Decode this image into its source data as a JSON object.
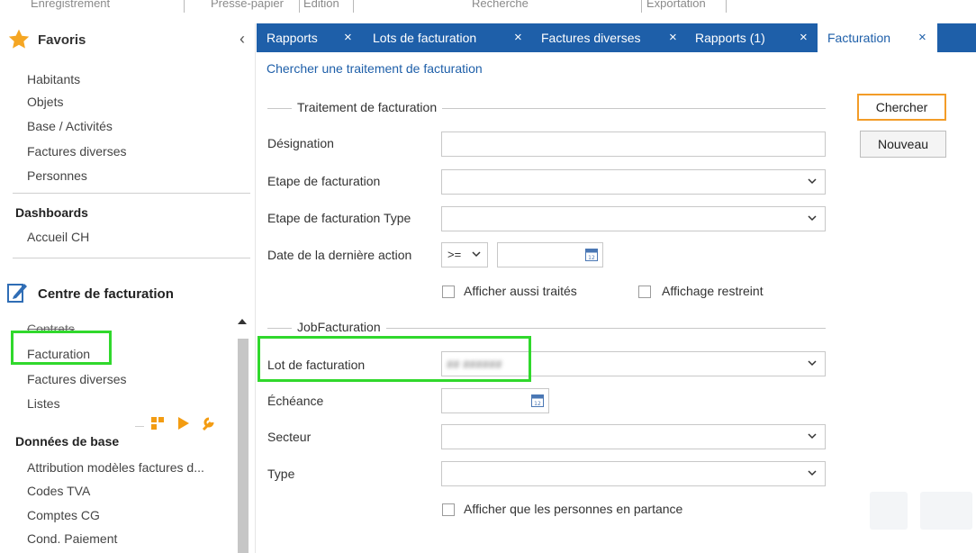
{
  "ribbon": {
    "groups": [
      "Enregistrement",
      "Presse-papier",
      "Edition",
      "Recherche",
      "Exportation"
    ]
  },
  "sidebar": {
    "favorites_title": "Favoris",
    "collapse_glyph": "‹",
    "favorites": [
      "Habitants",
      "Objets",
      "Base / Activités",
      "Factures diverses",
      "Personnes"
    ],
    "dashboards_title": "Dashboards",
    "dashboards": [
      "Accueil CH"
    ],
    "centre_title": "Centre de facturation",
    "centre_items": [
      "Contrats",
      "Facturation",
      "Factures diverses",
      "Listes"
    ],
    "base_title": "Données de base",
    "base_items": [
      "Attribution modèles factures d...",
      "Codes TVA",
      "Comptes CG",
      "Cond. Paiement"
    ],
    "tool_icons": [
      "blocks-icon",
      "play-icon",
      "wrench-icon"
    ]
  },
  "tabs": [
    {
      "label": "Rapports",
      "active": false
    },
    {
      "label": "Lots de facturation",
      "active": false
    },
    {
      "label": "Factures diverses",
      "active": false
    },
    {
      "label": "Rapports (1)",
      "active": false
    },
    {
      "label": "Facturation",
      "active": true
    }
  ],
  "tab_close_glyph": "×",
  "content": {
    "title": "Chercher une traitement de facturation",
    "section1": "Traitement de facturation",
    "section2": "JobFacturation",
    "fields": {
      "designation": {
        "label": "Désignation",
        "value": ""
      },
      "etape": {
        "label": "Etape de facturation",
        "value": ""
      },
      "etape_type": {
        "label": "Etape de facturation Type",
        "value": ""
      },
      "date_action": {
        "label": "Date de la dernière action",
        "operator": ">=",
        "value": ""
      },
      "lot": {
        "label": "Lot de facturation",
        "value": "## ######"
      },
      "echeance": {
        "label": "Échéance",
        "value": ""
      },
      "secteur": {
        "label": "Secteur",
        "value": ""
      },
      "type": {
        "label": "Type",
        "value": ""
      }
    },
    "checkboxes": {
      "afficher_traites": {
        "label": "Afficher aussi traités",
        "checked": false
      },
      "affichage_restreint": {
        "label": "Affichage restreint",
        "checked": false
      },
      "personnes_partance": {
        "label": "Afficher que les personnes en partance",
        "checked": false
      }
    },
    "buttons": {
      "search": "Chercher",
      "new": "Nouveau"
    }
  },
  "colors": {
    "tab_bar": "#1e5fa9",
    "link": "#1e5fa9",
    "highlight": "#30d82c",
    "primary_border": "#f39c28",
    "star": "#f5a623"
  }
}
